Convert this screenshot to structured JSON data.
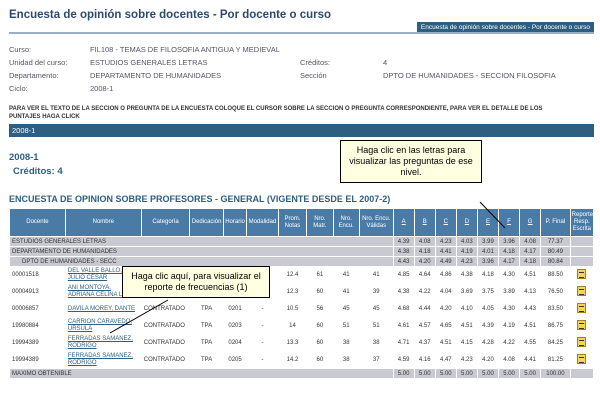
{
  "page": {
    "title": "Encuesta de opinión sobre docentes - Por docente o curso",
    "top_link": "Encuesta de opinión sobre docentes - Por docente o curso"
  },
  "info": {
    "curso_label": "Curso:",
    "curso_value": "FIL108 - TEMAS DE FILOSOFIA ANTIGUA Y MEDIEVAL",
    "unidad_label": "Unidad del curso:",
    "unidad_value": "ESTUDIOS GENERALES LETRAS",
    "creditos_label": "Créditos:",
    "creditos_value": "4",
    "depto_label": "Departamento:",
    "depto_value": "DEPARTAMENTO DE HUMANIDADES",
    "seccion_label": "Sección",
    "seccion_value": "DPTO DE HUMANIDADES - SECCION FILOSOFIA",
    "ciclo_label": "Ciclo:",
    "ciclo_value": "2008-1"
  },
  "instructions": "PARA VER EL TEXTO DE LA SECCION O PREGUNTA DE LA ENCUESTA COLOQUE EL CURSOR SOBRE LA SECCION O PREGUNTA CORRESPONDIENTE, PARA VER EL DETALLE DE LOS PUNTAJES HAGA CLICK",
  "section": {
    "bar_label": "2008-1",
    "year": "2008-1",
    "credits": "Créditos: 4",
    "survey_title": "ENCUESTA DE OPINION SOBRE PROFESORES - GENERAL (VIGENTE DESDE EL 2007-2)"
  },
  "table": {
    "headers": [
      "Docente",
      "Nombre",
      "Categoría",
      "Dedicación",
      "Horario",
      "Modalidad",
      "Prom. Notas",
      "Nro. Matr.",
      "Nro. Encu.",
      "Nro. Encu. Válidas",
      "A",
      "B",
      "C",
      "D",
      "E",
      "F",
      "G",
      "P. Final",
      "Reporte Resp. Escrita"
    ],
    "groups": [
      {
        "label": "ESTUDIOS GENERALES LETRAS",
        "A": "4.39",
        "B": "4.08",
        "C": "4.23",
        "D": "4.03",
        "E": "3.99",
        "F": "3.96",
        "G": "4.08",
        "P": "77.37"
      },
      {
        "label": "DEPARTAMENTO DE HUMANIDADES",
        "A": "4.38",
        "B": "4.18",
        "C": "4.41",
        "D": "4.19",
        "E": "4.01",
        "F": "4.18",
        "G": "4.17",
        "P": "80.49"
      },
      {
        "label": "DPTO DE HUMANIDADES - SECC",
        "A": "4.43",
        "B": "4.20",
        "C": "4.49",
        "D": "4.23",
        "E": "3.96",
        "F": "4.17",
        "G": "4.18",
        "P": "80.84"
      }
    ],
    "rows": [
      {
        "docente": "00001518",
        "nombre": "DEL VALLE BALLO, JULIO CÉSAR",
        "categoria": "",
        "dedicacion": "",
        "horario": "",
        "modalidad": "",
        "prom": "12.4",
        "matr": "61",
        "encu": "41",
        "valid": "41",
        "A": "4.85",
        "B": "4.64",
        "C": "4.86",
        "D": "4.38",
        "E": "4.18",
        "F": "4.30",
        "G": "4.51",
        "P": "88.50"
      },
      {
        "docente": "00004913",
        "nombre": "AÑI MONTOYA, ADRIANA CELINA LUCÍA",
        "categoria": "",
        "dedicacion": "",
        "horario": "",
        "modalidad": "",
        "prom": "12.3",
        "matr": "60",
        "encu": "41",
        "valid": "39",
        "A": "4.38",
        "B": "4.22",
        "C": "4.04",
        "D": "3.69",
        "E": "3.75",
        "F": "3.89",
        "G": "4.13",
        "P": "76.50"
      },
      {
        "docente": "00006857",
        "nombre": "DAVILA MOREY, DANTE",
        "categoria": "CONTRATADO",
        "dedicacion": "TPA",
        "horario": "0201",
        "modalidad": "-",
        "prom": "10.5",
        "matr": "56",
        "encu": "45",
        "valid": "45",
        "A": "4.68",
        "B": "4.44",
        "C": "4.20",
        "D": "4.10",
        "E": "4.05",
        "F": "4.30",
        "G": "4.43",
        "P": "83.50"
      },
      {
        "docente": "19980884",
        "nombre": "CARRIÓN CARAVEDO, URSULA",
        "categoria": "CONTRATADO",
        "dedicacion": "TPA",
        "horario": "0203",
        "modalidad": "-",
        "prom": "14",
        "matr": "60",
        "encu": "51",
        "valid": "51",
        "A": "4.61",
        "B": "4.57",
        "C": "4.65",
        "D": "4.51",
        "E": "4.39",
        "F": "4.19",
        "G": "4.51",
        "P": "86.75"
      },
      {
        "docente": "19994389",
        "nombre": "FERRADAS SAMANEZ, RODRIGO",
        "categoria": "CONTRATADO",
        "dedicacion": "TPA",
        "horario": "0204",
        "modalidad": "-",
        "prom": "13.3",
        "matr": "60",
        "encu": "38",
        "valid": "38",
        "A": "4.71",
        "B": "4.37",
        "C": "4.51",
        "D": "4.15",
        "E": "4.28",
        "F": "4.22",
        "G": "4.55",
        "P": "84.25"
      },
      {
        "docente": "19994389",
        "nombre": "FERRADAS SAMANEZ, RODRIGO",
        "categoria": "CONTRATADO",
        "dedicacion": "TPA",
        "horario": "0205",
        "modalidad": "-",
        "prom": "14.2",
        "matr": "60",
        "encu": "38",
        "valid": "37",
        "A": "4.59",
        "B": "4.16",
        "C": "4.47",
        "D": "4.23",
        "E": "4.20",
        "F": "4.08",
        "G": "4.41",
        "P": "81.25"
      }
    ],
    "max_row": {
      "label": "MAXIMO OBTENIBLE",
      "A": "5.00",
      "B": "5.00",
      "C": "5.00",
      "D": "5.00",
      "E": "5.00",
      "F": "5.00",
      "G": "5.00",
      "P": "100.00"
    }
  },
  "callouts": {
    "letters": "Haga clic en las letras para visualizar las preguntas de ese nivel.",
    "frequencies": "Haga clic aquí, para visualizar el reporte de frecuencias (1)"
  },
  "colors": {
    "header_blue": "#4a7ba7",
    "bar_blue": "#2e5f80",
    "group_gray": "#c9c9d1",
    "callout_bg": "#ffffe1"
  },
  "icons": {
    "report": "report-document-icon"
  }
}
